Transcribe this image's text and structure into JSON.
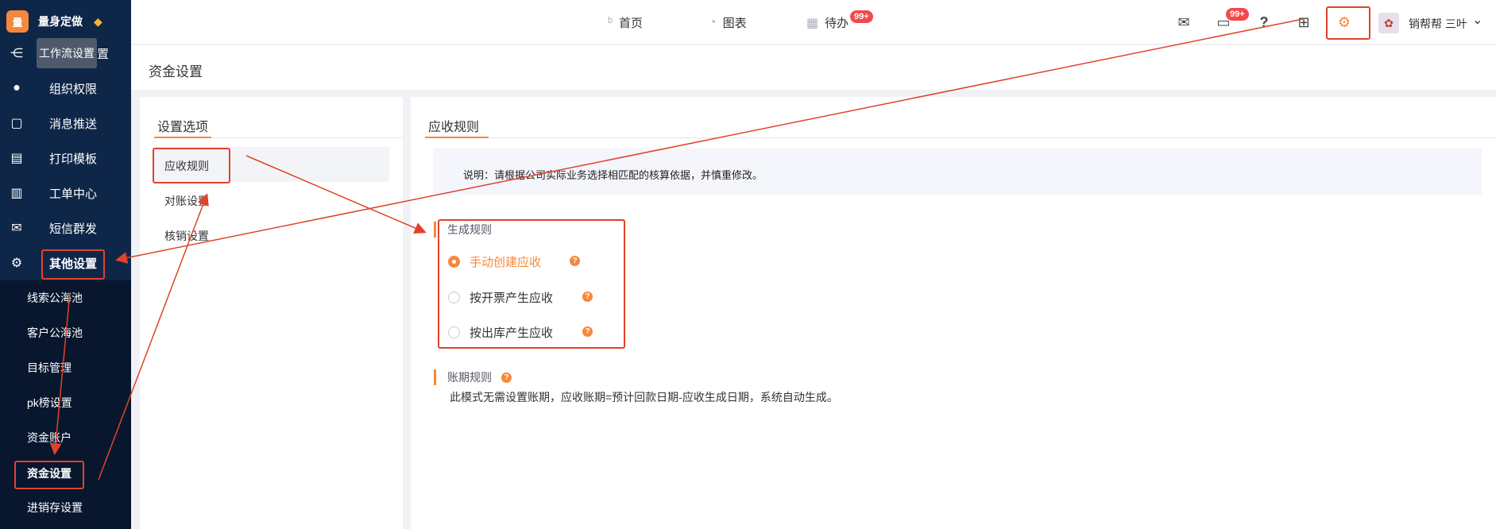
{
  "brand": {
    "logo_char": "量",
    "name": "量身定做",
    "gem": "◆"
  },
  "tooltip": "工作流设置",
  "sidebar": {
    "items": [
      {
        "label": "工作流设置",
        "icon": "workflow-icon",
        "glyph": "⋲"
      },
      {
        "label": "组织权限",
        "icon": "user-circle-icon",
        "glyph": "●"
      },
      {
        "label": "消息推送",
        "icon": "message-icon",
        "glyph": "▢"
      },
      {
        "label": "打印模板",
        "icon": "printer-icon",
        "glyph": "▤"
      },
      {
        "label": "工单中心",
        "icon": "clipboard-icon",
        "glyph": "▥"
      },
      {
        "label": "短信群发",
        "icon": "mail-icon",
        "glyph": "✉"
      },
      {
        "label": "其他设置",
        "icon": "gear-icon",
        "glyph": "⚙"
      }
    ],
    "subitems": [
      "线索公海池",
      "客户公海池",
      "目标管理",
      "pk榜设置",
      "资金账户",
      "资金设置",
      "进销存设置"
    ]
  },
  "topbar": {
    "tabs": [
      {
        "label": "首页",
        "icon": "home-icon",
        "glyph": "ᵇ"
      },
      {
        "label": "图表",
        "icon": "chart-icon",
        "glyph": "◔"
      },
      {
        "label": "待办",
        "icon": "calendar-icon",
        "glyph": "▦"
      }
    ],
    "todo_badge": "99+",
    "msg_badge": "99+",
    "user_name": "销帮帮 三叶",
    "chevron": "⌄",
    "icons": {
      "mail": "✉",
      "chat": "▭",
      "help": "?",
      "grid": "⊞",
      "settings": "⚙",
      "avatar": "✿"
    }
  },
  "page": {
    "title": "资金设置"
  },
  "settings_panel": {
    "title": "设置选项",
    "options": [
      "应收规则",
      "对账设置",
      "核销设置"
    ]
  },
  "main": {
    "title": "应收规则",
    "note": "说明：请根据公司实际业务选择相匹配的核算依据，并慎重修改。",
    "generate_rule_label": "生成规则",
    "radios": [
      {
        "label": "手动创建应收",
        "checked": true
      },
      {
        "label": "按开票产生应收",
        "checked": false
      },
      {
        "label": "按出库产生应收",
        "checked": false
      }
    ],
    "period_rule_label": "账期规则",
    "period_text": "此模式无需设置账期，应收账期=预计回款日期-应收生成日期，系统自动生成。",
    "help_glyph": "?"
  },
  "colors": {
    "accent": "#f5883b",
    "annotation": "#e1422a",
    "sidebar": "#0e2749"
  }
}
